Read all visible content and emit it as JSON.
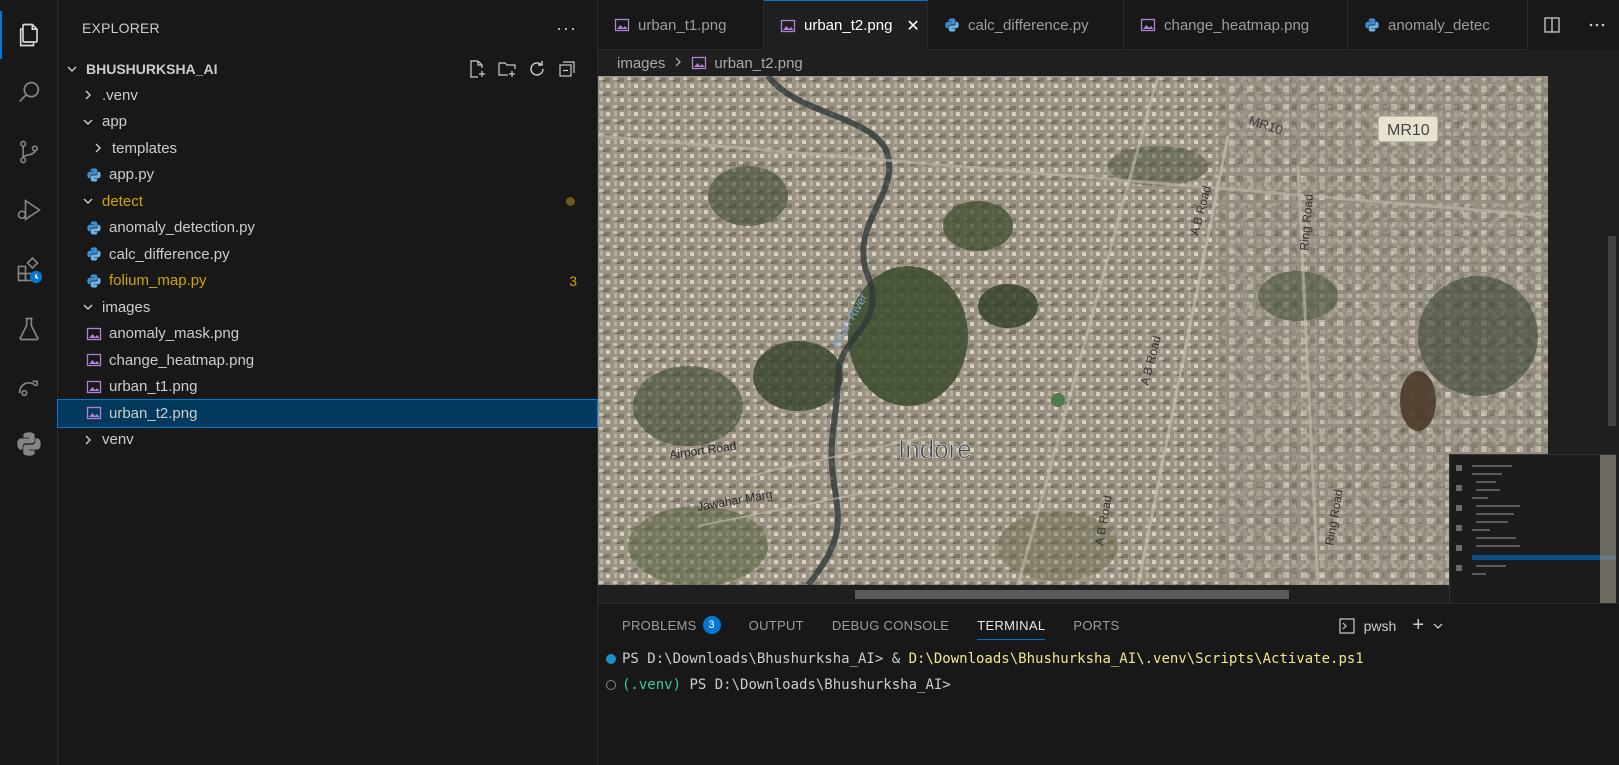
{
  "activity_bar": {
    "items": [
      "explorer-icon",
      "search-icon",
      "source-control-icon",
      "run-debug-icon",
      "extensions-icon",
      "testing-icon",
      "remote-icon",
      "python-icon"
    ]
  },
  "sidebar": {
    "title": "EXPLORER",
    "more": "···",
    "root_folder": "BHUSHURKSHA_AI",
    "tree": [
      {
        "label": ".venv",
        "type": "folder",
        "expanded": false,
        "depth": 0
      },
      {
        "label": "app",
        "type": "folder",
        "expanded": true,
        "depth": 0
      },
      {
        "label": "templates",
        "type": "folder",
        "expanded": false,
        "depth": 1
      },
      {
        "label": "app.py",
        "type": "python",
        "depth": 1
      },
      {
        "label": "detect",
        "type": "folder",
        "expanded": true,
        "depth": 0,
        "modified": true
      },
      {
        "label": "anomaly_detection.py",
        "type": "python",
        "depth": 1
      },
      {
        "label": "calc_difference.py",
        "type": "python",
        "depth": 1
      },
      {
        "label": "folium_map.py",
        "type": "python",
        "depth": 1,
        "problems": "3"
      },
      {
        "label": "images",
        "type": "folder",
        "expanded": true,
        "depth": 0
      },
      {
        "label": "anomaly_mask.png",
        "type": "image",
        "depth": 1
      },
      {
        "label": "change_heatmap.png",
        "type": "image",
        "depth": 1
      },
      {
        "label": "urban_t1.png",
        "type": "image",
        "depth": 1
      },
      {
        "label": "urban_t2.png",
        "type": "image",
        "depth": 1,
        "selected": true
      },
      {
        "label": "venv",
        "type": "folder",
        "expanded": false,
        "depth": 0
      }
    ]
  },
  "tabs": [
    {
      "label": "urban_t1.png",
      "type": "image",
      "active": false
    },
    {
      "label": "urban_t2.png",
      "type": "image",
      "active": true
    },
    {
      "label": "calc_difference.py",
      "type": "python",
      "active": false
    },
    {
      "label": "change_heatmap.png",
      "type": "image",
      "active": false
    },
    {
      "label": "anomaly_detec",
      "type": "python",
      "active": false
    }
  ],
  "breadcrumb": {
    "folder": "images",
    "file": "urban_t2.png"
  },
  "map": {
    "labels": {
      "city": "Indore",
      "mr10_road": "MR10",
      "mr10_shield": "MR10",
      "ab_road_1": "A B Road",
      "ab_road_2": "A B Road",
      "ab_road_3": "A B Road",
      "ring_road_1": "Ring Road",
      "ring_road_2": "Ring Road",
      "airport_road": "Airport Road",
      "jawahar_marg": "Jawahar Marg",
      "river": "Khan River"
    }
  },
  "panel": {
    "tabs": {
      "problems": "PROBLEMS",
      "problems_count": "3",
      "output": "OUTPUT",
      "debug_console": "DEBUG CONSOLE",
      "terminal": "TERMINAL",
      "ports": "PORTS"
    },
    "shell": "pwsh",
    "terminal": {
      "line1_prompt": "PS D:\\Downloads\\Bhushurksha_AI> & ",
      "line1_path": "D:\\Downloads\\Bhushurksha_AI\\.venv\\Scripts\\Activate.ps1",
      "line2_venv": "(.venv)",
      "line2_prompt": " PS D:\\Downloads\\Bhushurksha_AI>"
    }
  },
  "colors": {
    "accent": "#0078d4",
    "warning": "#cca700",
    "selection": "#04395e",
    "python": "#3b8fd1",
    "image_icon": "#b180d7"
  }
}
